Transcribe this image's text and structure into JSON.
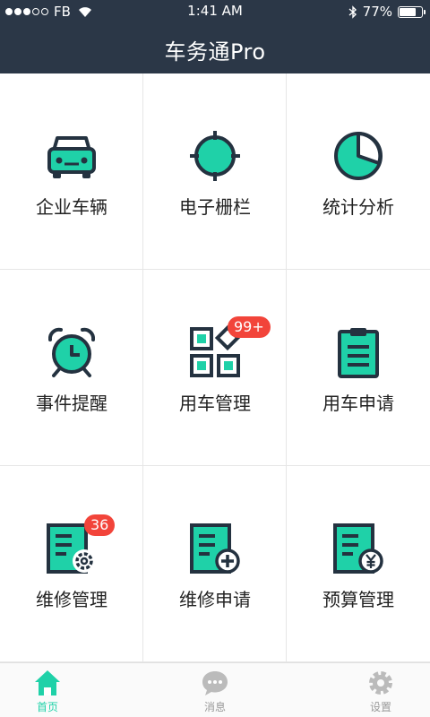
{
  "status_bar": {
    "carrier": "FB",
    "time": "1:41 AM",
    "battery": "77%",
    "battery_level": 0.77,
    "signal_bars": 3
  },
  "header": {
    "title": "车务通Pro"
  },
  "colors": {
    "accent": "#1fd1a8",
    "outline": "#243240",
    "header_bg": "#2b3747",
    "badge": "#f2443a",
    "tab_inactive": "#bbbbbb"
  },
  "grid": {
    "items": [
      {
        "label": "企业车辆",
        "icon": "car-icon"
      },
      {
        "label": "电子栅栏",
        "icon": "geofence-target-icon"
      },
      {
        "label": "统计分析",
        "icon": "pie-chart-icon"
      },
      {
        "label": "事件提醒",
        "icon": "alarm-clock-icon"
      },
      {
        "label": "用车管理",
        "icon": "apps-grid-icon",
        "badge": "99+"
      },
      {
        "label": "用车申请",
        "icon": "clipboard-icon"
      },
      {
        "label": "维修管理",
        "icon": "document-gear-icon",
        "badge": "36"
      },
      {
        "label": "维修申请",
        "icon": "document-plus-icon"
      },
      {
        "label": "预算管理",
        "icon": "document-yen-icon"
      }
    ]
  },
  "tabbar": {
    "tabs": [
      {
        "label": "首页",
        "icon": "home-icon",
        "active": true
      },
      {
        "label": "消息",
        "icon": "chat-bubble-icon",
        "active": false
      },
      {
        "label": "设置",
        "icon": "gear-icon",
        "active": false
      }
    ]
  }
}
